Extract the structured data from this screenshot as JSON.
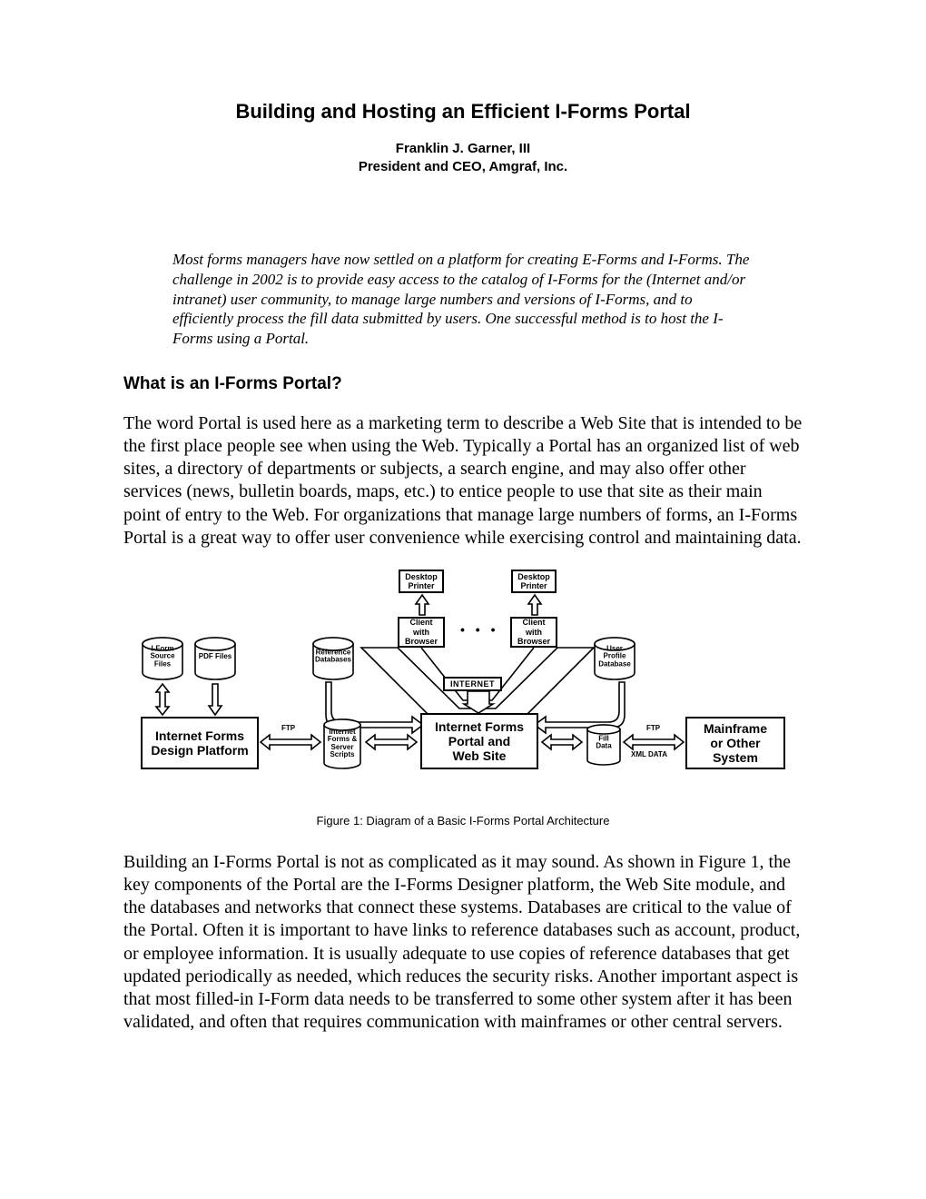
{
  "title": "Building and Hosting an Efficient I-Forms Portal",
  "byline": {
    "author": "Franklin J. Garner, III",
    "role": "President and CEO, Amgraf, Inc."
  },
  "abstract": "Most forms managers have now settled on a platform for creating E-Forms and I-Forms. The challenge in 2002 is to provide easy access to the catalog of I-Forms for the (Internet and/or intranet) user community, to manage large numbers and versions of I-Forms, and to efficiently process the fill data submitted by users. One successful method is to host the I-Forms using a Portal.",
  "section1_heading": "What is an I-Forms Portal?",
  "para1": "The word Portal is used here as a marketing term to describe a Web Site that is intended to be the first place people see when using the Web. Typically a Portal has an organized list of web sites, a directory of departments or subjects, a search engine, and may also offer other services (news, bulletin boards, maps, etc.) to entice people to use that site as their main point of entry to the Web. For organizations that manage large numbers of forms, an I-Forms Portal is a great way to offer user convenience while exercising control and maintaining data.",
  "figure": {
    "caption": "Figure 1: Diagram of a Basic I-Forms Portal Architecture",
    "labels": {
      "desktop_printer1": "Desktop\nPrinter",
      "desktop_printer2": "Desktop\nPrinter",
      "client1": "Client\nwith\nBrowser",
      "client2": "Client\nwith\nBrowser",
      "internet": "INTERNET",
      "iform_src": "I-Form\nSource\nFiles",
      "pdf_files": "PDF Files",
      "ref_db": "Reference\nDatabases",
      "user_profile": "User\nProfile\nDatabase",
      "design_platform": "Internet Forms\nDesign Platform",
      "forms_scripts": "Internet\nForms &\nServer\nScripts",
      "portal": "Internet Forms\nPortal and\nWeb Site",
      "fill_data": "Fill\nData",
      "mainframe": "Mainframe\nor Other\nSystem",
      "ftp1": "FTP",
      "ftp2": "FTP",
      "xml": "XML DATA",
      "dots": "• • •"
    }
  },
  "para2": "Building an I-Forms Portal is not as complicated as it may sound. As shown in Figure 1, the key components of the Portal are the I-Forms Designer platform, the Web Site module, and the databases and networks that connect these systems. Databases are critical to the value of the Portal. Often it is important to have links to reference databases such as account, product, or employee information. It is usually adequate to use copies of reference databases that get updated periodically as needed, which reduces the security risks. Another important aspect is that most filled-in I-Form data needs to be transferred to some other system after it has been validated, and often that requires communication with mainframes or other central servers."
}
